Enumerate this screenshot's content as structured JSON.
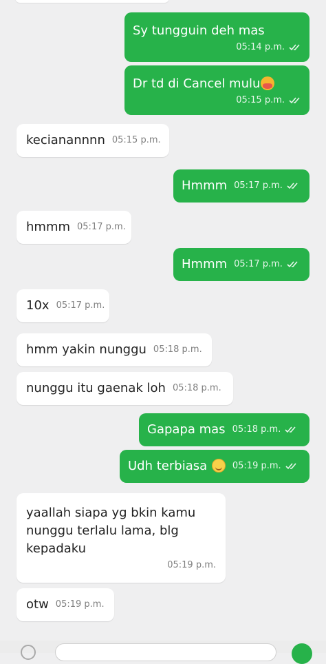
{
  "chat": {
    "messages": [
      {
        "dir": "out",
        "text": "Sy tungguin deh mas",
        "time": "05:14 p.m."
      },
      {
        "dir": "out",
        "text": "Dr td di Cancel mulu",
        "emoji": "sad-face-emoji",
        "time": "05:15 p.m."
      },
      {
        "dir": "in",
        "text": "kecianannnn",
        "time": "05:15 p.m."
      },
      {
        "dir": "out",
        "text": "Hmmm",
        "time": "05:17 p.m."
      },
      {
        "dir": "in",
        "text": "hmmm",
        "time": "05:17 p.m."
      },
      {
        "dir": "out",
        "text": "Hmmm",
        "time": "05:17 p.m."
      },
      {
        "dir": "in",
        "text": "10x",
        "time": "05:17 p.m."
      },
      {
        "dir": "in",
        "text": "hmm yakin nunggu",
        "time": "05:18 p.m."
      },
      {
        "dir": "in",
        "text": "nunggu itu gaenak loh",
        "time": "05:18 p.m."
      },
      {
        "dir": "out",
        "text": "Gapapa mas",
        "time": "05:18 p.m."
      },
      {
        "dir": "out",
        "text": "Udh terbiasa",
        "emoji": "smiling-face-emoji",
        "time": "05:19 p.m."
      },
      {
        "dir": "in",
        "text": "yaallah siapa yg bkin kamu nunggu terlalu lama, blg kepadaku",
        "time": "05:19 p.m."
      },
      {
        "dir": "in",
        "text": "otw",
        "time": "05:19 p.m."
      }
    ]
  },
  "icons": {
    "read_receipt": "double-check-icon",
    "read_receipt_color": "#e8f7ec"
  },
  "colors": {
    "background": "#efeff0",
    "outgoing_bubble": "#27b24a",
    "incoming_bubble": "#ffffff"
  }
}
